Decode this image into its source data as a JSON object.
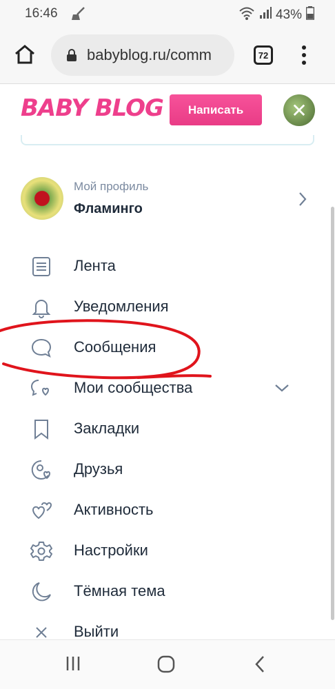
{
  "status_bar": {
    "time": "16:46",
    "battery": "43%"
  },
  "browser": {
    "url": "babyblog.ru/comm",
    "tab_count": "72"
  },
  "site": {
    "logo": "BABY BLOG",
    "write_button": "Написать"
  },
  "profile": {
    "caption": "Мой профиль",
    "name": "Фламинго"
  },
  "menu": {
    "items": [
      {
        "label": "Лента",
        "icon": "feed-icon"
      },
      {
        "label": "Уведомления",
        "icon": "bell-icon"
      },
      {
        "label": "Сообщения",
        "icon": "chat-bubble-icon"
      },
      {
        "label": "Мои сообщества",
        "icon": "communities-icon"
      },
      {
        "label": "Закладки",
        "icon": "bookmark-icon"
      },
      {
        "label": "Друзья",
        "icon": "friends-icon"
      },
      {
        "label": "Активность",
        "icon": "hearts-icon"
      },
      {
        "label": "Настройки",
        "icon": "gear-icon"
      },
      {
        "label": "Тёмная тема",
        "icon": "moon-icon"
      },
      {
        "label": "Выйти",
        "icon": "close-icon"
      }
    ]
  },
  "colors": {
    "brand": "#ee3f8c",
    "text": "#1f2b3a",
    "icon": "#6f7f95",
    "annotation": "#e0141c"
  }
}
